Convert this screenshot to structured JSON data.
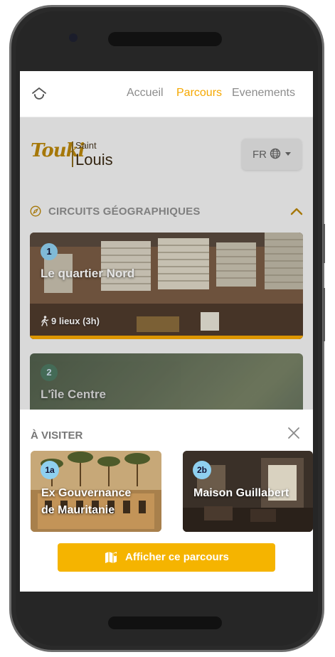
{
  "nav": {
    "home_icon": "home-icon",
    "links": [
      "Accueil",
      "Parcours",
      "Evenements"
    ],
    "active": "Parcours",
    "accent_color": "#f5a800"
  },
  "header": {
    "logo_script": "Touki",
    "logo_saint": "Saint",
    "logo_louis": "Louis",
    "language": "FR",
    "language_icon": "globe-icon"
  },
  "section": {
    "icon": "compass-icon",
    "title": "CIRCUITS GÉOGRAPHIQUES",
    "toggle_icon": "chevron-up-icon"
  },
  "circuits": [
    {
      "number": "1",
      "title": "Le quartier Nord",
      "meta": "9 lieux (3h)",
      "meta_icon": "walking-icon"
    },
    {
      "number": "2",
      "title": "L'île Centre"
    }
  ],
  "sheet": {
    "title": "À VISITER",
    "close_icon": "close-icon",
    "places": [
      {
        "badge": "1a",
        "title_line1": "Ex Gouvernance",
        "title_line2": "de Mauritanie"
      },
      {
        "badge": "2b",
        "title_line1": "Maison Guillabert"
      }
    ],
    "cta_label": "Afficher ce parcours",
    "cta_icon": "map-icon",
    "cta_color": "#f5b400"
  }
}
